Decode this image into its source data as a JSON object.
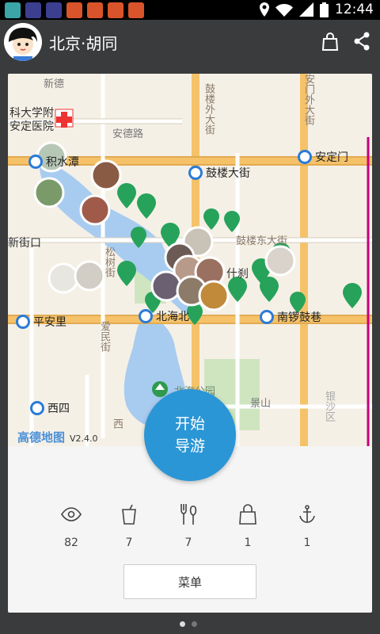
{
  "status_bar": {
    "time": "12:44",
    "notification_icons": [
      "teal-app-icon",
      "eye-app-icon",
      "eye-app-icon",
      "red-app-icon",
      "red-app-icon",
      "red-app-icon",
      "red-app-icon"
    ]
  },
  "app_bar": {
    "title": "北京·胡同"
  },
  "map": {
    "labels": {
      "hospital": "科大学附\n安定医院",
      "andelu": "安德路",
      "gulouwai": "鼓楼外大街",
      "anding_gate_outer": "安门外大街",
      "xinjiekou_wai": "新德",
      "xinjiekou": "新街口",
      "houhai": "松树街",
      "gulou_east": "鼓楼东大街",
      "shichahai": "什刹",
      "dianmen": "景山",
      "beihai_park": "北海公园",
      "aimin": "爱民街",
      "xisi_road": "西",
      "east_side": "银沙区"
    },
    "stations": {
      "jishuitan": "积水潭",
      "anding_gate": "安定门",
      "gulou": "鼓楼大街",
      "pinganli": "平安里",
      "beihai_north": "北海北",
      "nanluo": "南锣鼓巷",
      "xisi": "西四"
    },
    "logo": "高德地图",
    "version": "V2.4.0"
  },
  "start_button": {
    "line1": "开始",
    "line2": "导游"
  },
  "stats": [
    {
      "icon": "eye-icon",
      "value": "82"
    },
    {
      "icon": "drink-icon",
      "value": "7"
    },
    {
      "icon": "utensils-icon",
      "value": "7"
    },
    {
      "icon": "bag-icon",
      "value": "1"
    },
    {
      "icon": "anchor-icon",
      "value": "1"
    }
  ],
  "menu_label": "菜单",
  "colors": {
    "accent": "#2b96d6",
    "pin": "#27a25a",
    "road_major": "#f5c26a",
    "water": "#a8ccf0",
    "park": "#cfe5c0"
  }
}
